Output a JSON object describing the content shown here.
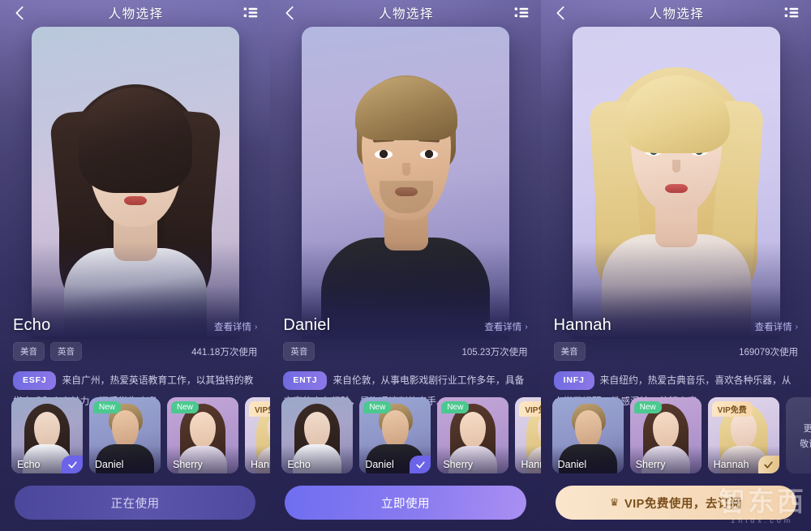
{
  "header": {
    "title": "人物选择",
    "back_icon": "chevron-left-icon",
    "menu_icon": "list-menu-icon"
  },
  "watermark": {
    "main": "智东西",
    "sub": "zhidx.com"
  },
  "panels": [
    {
      "name": "Echo",
      "detail_link": "查看详情",
      "chevron": "›",
      "tags": [
        "美音",
        "英音"
      ],
      "uses": "441.18万次使用",
      "mbti": "ESFJ",
      "bio": "来自广州，热爱英语教育工作，以其独特的教学方式和个人魅力，深受学生欢迎",
      "cta": "正在使用",
      "cta_style": "inuse",
      "thumbs": [
        {
          "name": "Echo",
          "badge": "",
          "selected": true
        },
        {
          "name": "Daniel",
          "badge": "New",
          "selected": false
        },
        {
          "name": "Sherry",
          "badge": "New",
          "selected": false
        },
        {
          "name": "Hannah",
          "badge": "VIP免费",
          "selected": false
        }
      ]
    },
    {
      "name": "Daniel",
      "detail_link": "查看详情",
      "chevron": "›",
      "tags": [
        "英音"
      ],
      "uses": "105.23万次使用",
      "mbti": "ENTJ",
      "bio": "来自伦敦，从事电影戏剧行业工作多年，具备丰富的商务经验，是沟通谈判的高手。",
      "cta": "立即使用",
      "cta_style": "now",
      "thumbs": [
        {
          "name": "Echo",
          "badge": "",
          "selected": false
        },
        {
          "name": "Daniel",
          "badge": "New",
          "selected": true
        },
        {
          "name": "Sherry",
          "badge": "New",
          "selected": false
        },
        {
          "name": "Hannah",
          "badge": "VIP免费",
          "selected": false
        }
      ]
    },
    {
      "name": "Hannah",
      "detail_link": "查看详情",
      "chevron": "›",
      "tags": [
        "美音"
      ],
      "uses": "169079次使用",
      "mbti": "INFJ",
      "bio": "来自纽约，热爱古典音乐，喜欢各种乐器，从小学习钢琴，性感温婉，善解人意。",
      "cta": "VIP免费使用，去订阅",
      "cta_style": "vip",
      "crown_icon": "crown-icon",
      "thumbs": [
        {
          "name": "Daniel",
          "badge": "",
          "selected": false
        },
        {
          "name": "Sherry",
          "badge": "New",
          "selected": false
        },
        {
          "name": "Hannah",
          "badge": "VIP免费",
          "selected": true
        }
      ],
      "more_card": {
        "line1": "更多人物",
        "line2": "敬请期待..."
      }
    }
  ]
}
